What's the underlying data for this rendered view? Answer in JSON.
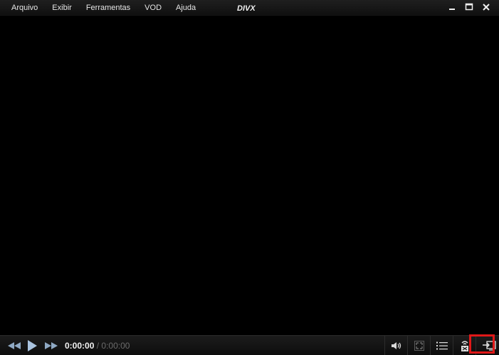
{
  "menu": {
    "items": [
      {
        "label": "Arquivo"
      },
      {
        "label": "Exibir"
      },
      {
        "label": "Ferramentas"
      },
      {
        "label": "VOD"
      },
      {
        "label": "Ajuda"
      }
    ]
  },
  "brand": {
    "logo_text": "DIVX",
    "logo_icon": "divx-logo"
  },
  "window_controls": {
    "minimize_icon": "minimize-icon",
    "maximize_icon": "maximize-icon",
    "close_icon": "close-icon"
  },
  "player": {
    "current_time": "0:00:00",
    "separator": "/",
    "duration": "0:00:00"
  },
  "controls": {
    "rewind_icon": "rewind-icon",
    "play_icon": "play-icon",
    "fast_forward_icon": "fast-forward-icon",
    "volume_icon": "volume-icon",
    "fullscreen_icon": "fullscreen-icon",
    "playlist_icon": "playlist-icon",
    "cast_icon": "cast-to-device-icon",
    "switch_mode_icon": "switch-view-icon"
  },
  "colors": {
    "background": "#000000",
    "highlight": "#e01818",
    "text": "#e6e6e6",
    "muted_text": "#6b6b6b"
  }
}
